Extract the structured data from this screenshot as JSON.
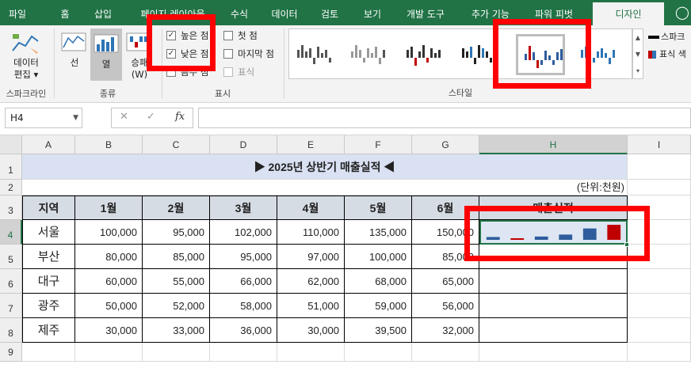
{
  "ribbon_tabs": [
    "파일",
    "홈",
    "삽입",
    "페이지 레이아웃",
    "수식",
    "데이터",
    "검토",
    "보기",
    "개발 도구",
    "추가 기능",
    "파워 피벗",
    "디자인"
  ],
  "ribbon": {
    "sparkline_group": {
      "edit_label": "데이터\n편집",
      "edit_label1": "데이터",
      "edit_label2": "편집",
      "group_label": "스파크라인"
    },
    "type_group": {
      "line": "선",
      "column": "열",
      "winloss": "승패\n(W)",
      "winloss1": "승패",
      "winloss2": "(W)",
      "group_label": "종류"
    },
    "show_group": {
      "high_point": "높은 점",
      "low_point": "낮은 점",
      "negative_points": "음수 점",
      "first_point": "첫 점",
      "last_point": "마지막 점",
      "markers": "표식",
      "group_label": "표시",
      "high_checked": true,
      "low_checked": true,
      "negative_checked": false,
      "first_checked": false,
      "last_checked": false,
      "markers_checked": false
    },
    "style_group": {
      "group_label": "스타일",
      "sparkline_color": "스파크",
      "marker_color": "표식 색",
      "selected_index": 4
    }
  },
  "formula_bar": {
    "name_box": "H4",
    "fx": "fx",
    "formula": ""
  },
  "columns": [
    "A",
    "B",
    "C",
    "D",
    "E",
    "F",
    "G",
    "H",
    "I"
  ],
  "rows": [
    "1",
    "2",
    "3",
    "4",
    "5",
    "6",
    "7",
    "8",
    "9"
  ],
  "title": "▶ 2025년 상반기 매출실적 ◀",
  "unit": "(단위:천원)",
  "table": {
    "headers": [
      "지역",
      "1월",
      "2월",
      "3월",
      "4월",
      "5월",
      "6월",
      "매출실적"
    ],
    "data": [
      [
        "서울",
        "100,000",
        "95,000",
        "102,000",
        "110,000",
        "135,000",
        "150,000"
      ],
      [
        "부산",
        "80,000",
        "85,000",
        "95,000",
        "97,000",
        "100,000",
        "85,000"
      ],
      [
        "대구",
        "60,000",
        "55,000",
        "66,000",
        "62,000",
        "68,000",
        "65,000"
      ],
      [
        "광주",
        "50,000",
        "52,000",
        "58,000",
        "51,000",
        "59,000",
        "56,000"
      ],
      [
        "제주",
        "30,000",
        "33,000",
        "36,000",
        "30,000",
        "39,500",
        "32,000"
      ]
    ]
  },
  "sparkline": {
    "values": [
      100000,
      95000,
      102000,
      110000,
      135000,
      150000
    ],
    "high_color": "#c00000",
    "low_color": "#c00000",
    "color": "#2e5c9c"
  },
  "colors": {
    "accent": "#217346",
    "highlight": "#ff0000",
    "header_fill": "#d6dce4"
  }
}
